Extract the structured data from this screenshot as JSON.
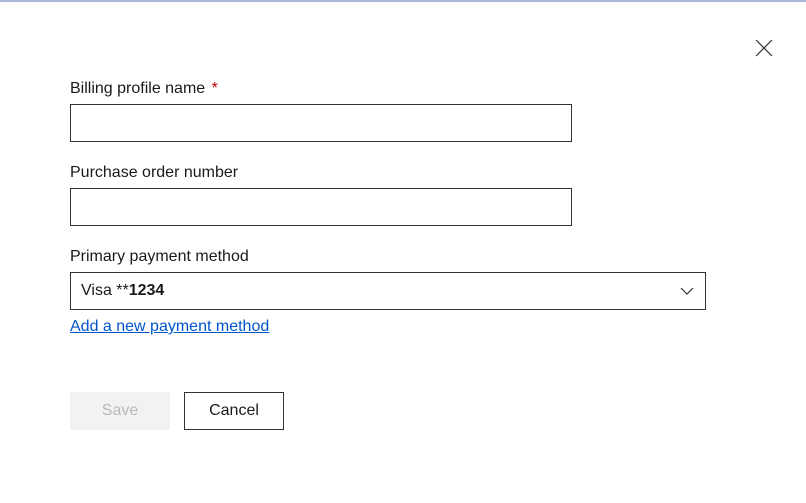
{
  "form": {
    "billing_profile_name": {
      "label": "Billing profile name",
      "required_mark": "*",
      "value": ""
    },
    "purchase_order_number": {
      "label": "Purchase order number",
      "value": ""
    },
    "primary_payment_method": {
      "label": "Primary payment method",
      "selected_prefix": "Visa **",
      "selected_digits": "1234"
    },
    "add_payment_link": "Add a new payment method"
  },
  "buttons": {
    "save": "Save",
    "cancel": "Cancel"
  }
}
